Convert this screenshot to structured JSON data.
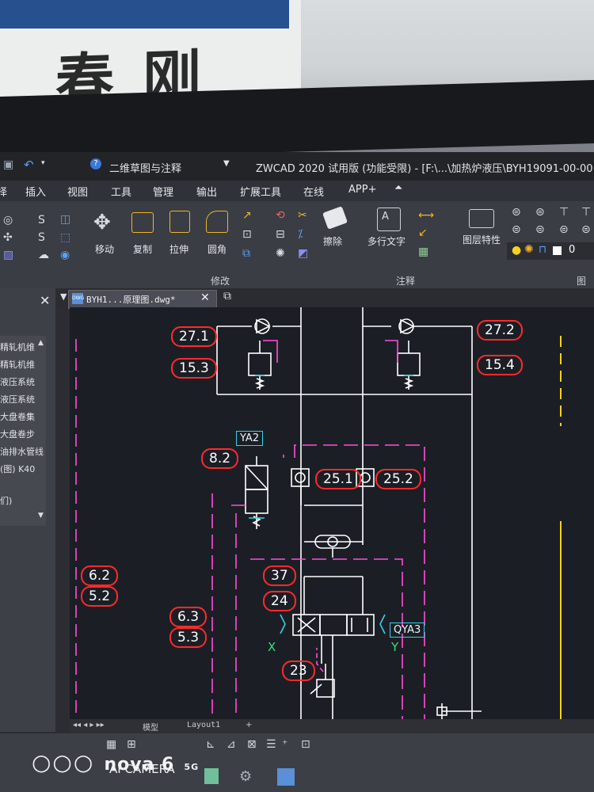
{
  "background": {
    "sign_text": "春刚"
  },
  "titlebar": {
    "workspace": "二维草图与注释",
    "title": "ZWCAD 2020 试用版 (功能受限) - [F:\\...\\加热炉液压\\BYH19091-00-00"
  },
  "menubar": {
    "items": [
      "插入",
      "视图",
      "工具",
      "管理",
      "输出",
      "扩展工具",
      "在线",
      "APP+"
    ]
  },
  "ribbon": {
    "buttons": [
      "移动",
      "复制",
      "拉伸",
      "圆角",
      "擦除",
      "多行文字",
      "图层特性"
    ],
    "sections": [
      "修改",
      "注释",
      "图层"
    ],
    "layer_value": "0"
  },
  "palette": {
    "items": [
      "精轧机维",
      "精轧机维",
      "液压系统",
      "液压系统",
      "大盘卷集",
      "大盘卷步",
      "油排水管线",
      "(图) K40",
      "们)"
    ]
  },
  "tabs": {
    "active": "BYH1...原理图.dwg*"
  },
  "statusbar": {
    "model": "模型",
    "layout": "Layout1"
  },
  "drawing": {
    "callouts": [
      "27.1",
      "27.2",
      "15.3",
      "15.4",
      "8.2",
      "25.1",
      "25.2",
      "37",
      "24",
      "6.2",
      "5.2",
      "6.3",
      "5.3",
      "23"
    ],
    "boxed_labels": [
      "YA2",
      "QYA3"
    ],
    "port_labels": [
      "X",
      "Y"
    ]
  },
  "watermark": {
    "brand": "nova 6",
    "suffix": "5G",
    "camera": "AI CAMERA"
  },
  "colors": {
    "callout": "#ff2a2a",
    "line": "#ffffff",
    "magenta": "#ff4fd8",
    "cyan": "#35d2e6",
    "yellow": "#f7d21c"
  }
}
